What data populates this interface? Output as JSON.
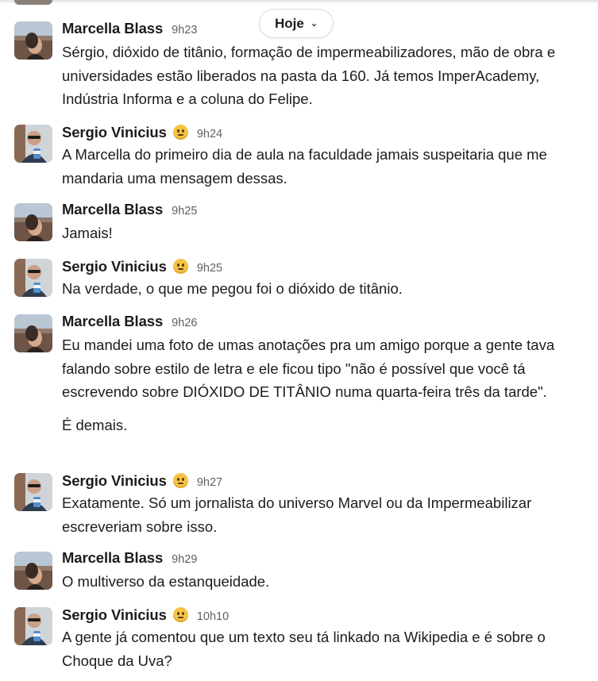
{
  "date_divider": {
    "label": "Hoje",
    "icon": "chevron-down-icon"
  },
  "users": {
    "marcella": {
      "name": "Marcella Blass",
      "avatar": "avatar-marcella"
    },
    "sergio": {
      "name": "Sergio Vinicius",
      "avatar": "avatar-sergio",
      "status_emoji": "slightly-smiling-face-icon"
    }
  },
  "messages": [
    {
      "author": "Marcella Blass",
      "time": "9h23",
      "paragraphs": [
        "Sérgio, dióxido de titânio, formação de impermeabilizadores, mão de obra e universidades estão liberados na pasta da 160. Já temos ImperAcademy, Indústria Informa e a coluna do Felipe."
      ]
    },
    {
      "author": "Sergio Vinicius",
      "time": "9h24",
      "paragraphs": [
        "A Marcella do primeiro dia de aula na faculdade jamais suspeitaria que me mandaria uma mensagem dessas."
      ]
    },
    {
      "author": "Marcella Blass",
      "time": "9h25",
      "paragraphs": [
        "Jamais!"
      ]
    },
    {
      "author": "Sergio Vinicius",
      "time": "9h25",
      "paragraphs": [
        "Na verdade, o que me pegou foi o dióxido de titânio."
      ]
    },
    {
      "author": "Marcella Blass",
      "time": "9h26",
      "paragraphs": [
        "Eu mandei uma foto de umas anotações pra um amigo porque a gente tava falando sobre estilo de letra e ele ficou tipo \"não é possível que você tá escrevendo sobre DIÓXIDO DE TITÂNIO numa quarta-feira três da tarde\".",
        "É demais."
      ]
    },
    {
      "author": "Sergio Vinicius",
      "time": "9h27",
      "paragraphs": [
        "Exatamente. Só um jornalista do universo Marvel ou da Impermeabilizar escreveriam sobre isso."
      ]
    },
    {
      "author": "Marcella Blass",
      "time": "9h29",
      "paragraphs": [
        "O multiverso da estanqueidade."
      ]
    },
    {
      "author": "Sergio Vinicius",
      "time": "10h10",
      "paragraphs": [
        "A gente já comentou que um texto seu tá linkado na Wikipedia e é sobre o Choque da Uva?"
      ]
    }
  ]
}
